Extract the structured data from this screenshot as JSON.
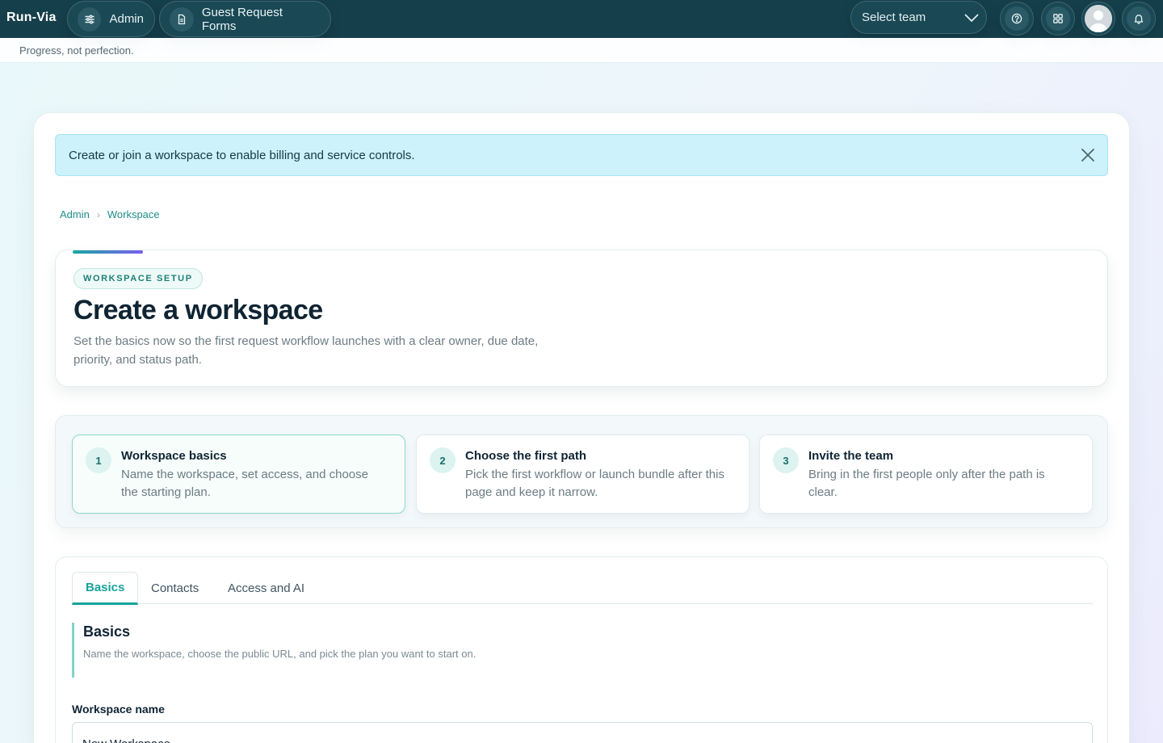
{
  "app": {
    "brand": "Run-Via",
    "motto": "Progress, not perfection."
  },
  "topbar": {
    "pills": [
      {
        "label": "Admin",
        "icon": "sliders-icon"
      },
      {
        "label": "Guest Request Forms",
        "icon": "document-icon"
      }
    ],
    "team_select": {
      "label": "Select team",
      "icon": "chevron-down-icon"
    },
    "buttons": [
      {
        "name": "help",
        "icon": "help-circle-icon"
      },
      {
        "name": "apps",
        "icon": "grid-icon"
      },
      {
        "name": "profile",
        "icon": "avatar"
      },
      {
        "name": "notifications",
        "icon": "bell-icon"
      }
    ]
  },
  "notice": {
    "text": "Create or join a workspace to enable billing and service controls.",
    "close_icon": "close-icon"
  },
  "breadcrumb": [
    "Admin",
    "Workspace"
  ],
  "hero": {
    "badge": "WORKSPACE SETUP",
    "title": "Create a workspace",
    "description": "Set the basics now so the first request workflow launches with a clear owner, due date, priority, and status path."
  },
  "steps": [
    {
      "number": "1",
      "title": "Workspace basics",
      "description": "Name the workspace, set access, and choose the starting plan.",
      "active": true
    },
    {
      "number": "2",
      "title": "Choose the first path",
      "description": "Pick the first workflow or launch bundle after this page and keep it narrow.",
      "active": false
    },
    {
      "number": "3",
      "title": "Invite the team",
      "description": "Bring in the first people only after the path is clear.",
      "active": false
    }
  ],
  "form": {
    "tabs": [
      {
        "label": "Basics",
        "active": true
      },
      {
        "label": "Contacts",
        "active": false
      },
      {
        "label": "Access and AI",
        "active": false
      }
    ],
    "section": {
      "title": "Basics",
      "description": "Name the workspace, choose the public URL, and pick the plan you want to start on."
    },
    "workspace_name": {
      "label": "Workspace name",
      "value": "New Workspace"
    }
  },
  "colors": {
    "topbar": "#163f4c",
    "accent": "#16a39b",
    "notice_bg": "#cdf2fb"
  }
}
